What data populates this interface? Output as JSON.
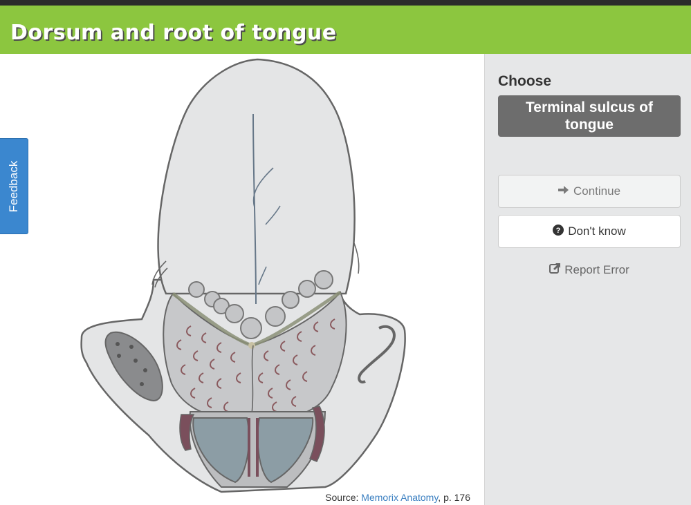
{
  "header": {
    "title": "Dorsum and root of tongue"
  },
  "feedback": {
    "label": "Feedback"
  },
  "panel": {
    "choose_label": "Choose",
    "term": "Terminal sulcus of tongue",
    "continue_label": "Continue",
    "dont_know_label": "Don't know",
    "report_label": "Report Error"
  },
  "source": {
    "prefix": "Source: ",
    "link_text": "Memorix Anatomy",
    "suffix": ", p. 176"
  },
  "icons": {
    "continue": "arrow-right-icon",
    "dont_know": "question-circle-icon",
    "report": "external-link-icon"
  },
  "colors": {
    "header_bg": "#8cc63f",
    "topbar_bg": "#2b2b2b",
    "panel_bg": "#e6e7e8",
    "term_bg": "#6d6d6d",
    "feedback_bg": "#3b87cf",
    "link": "#3a7fc1"
  }
}
